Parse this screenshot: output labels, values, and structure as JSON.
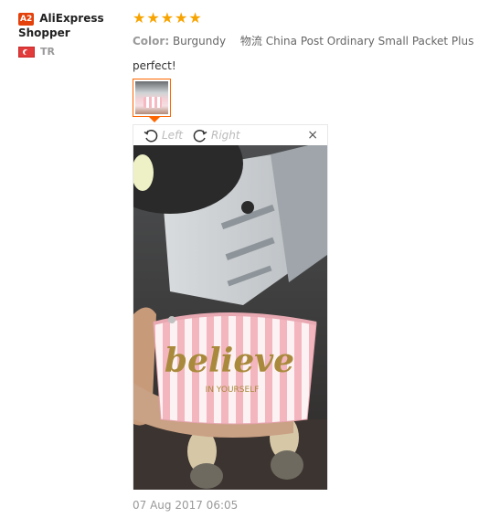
{
  "user": {
    "badge": "A2",
    "name_line1": "AliExpress",
    "name_line2": "Shopper",
    "country_code": "TR"
  },
  "review": {
    "rating": 5,
    "color_label": "Color:",
    "color_value": "Burgundy",
    "shipping_label": "物流",
    "shipping_value": "China Post Ordinary Small Packet Plus",
    "text": "perfect!",
    "date": "07 Aug 2017 06:05"
  },
  "viewer": {
    "rotate_left": "Left",
    "rotate_right": "Right",
    "close": "×"
  },
  "photo": {
    "pouch_main_text": "believe",
    "pouch_sub_text": "IN YOURSELF"
  },
  "colors": {
    "star": "#f7a400",
    "accent": "#ff6600",
    "badge": "#e4410b"
  }
}
